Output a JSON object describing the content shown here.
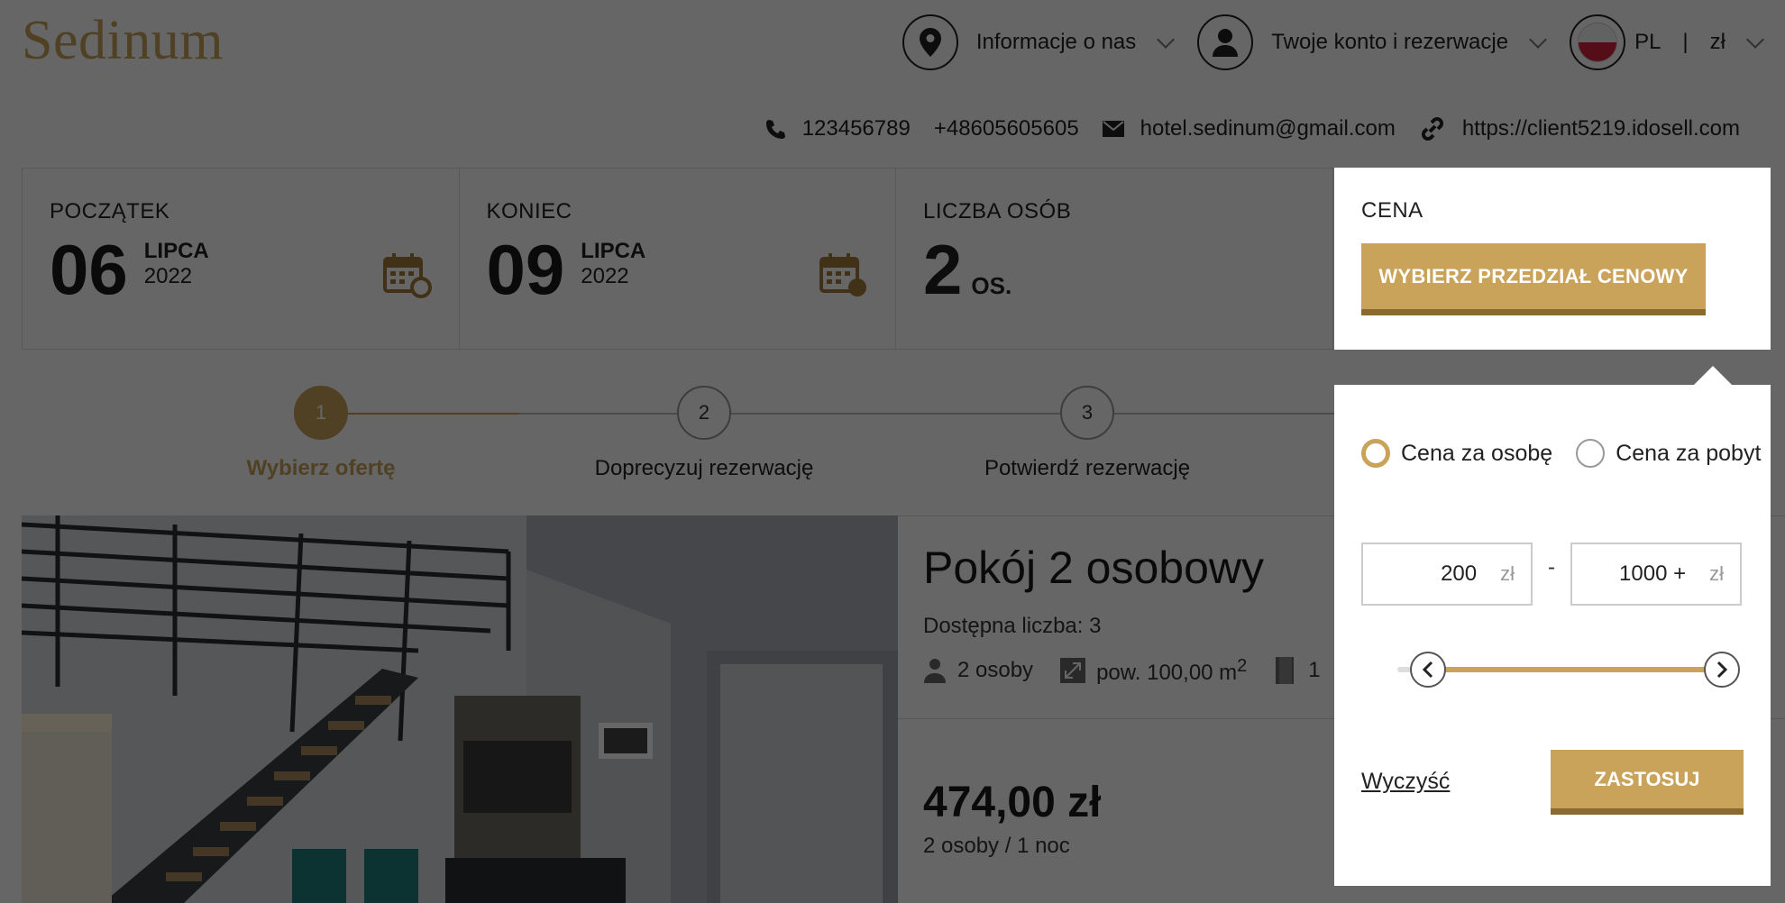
{
  "brand": {
    "logo": "Sedinum",
    "accent": "#c9a35a"
  },
  "nav": {
    "about": "Informacje o nas",
    "account": "Twoje konto i rezerwacje",
    "lang": "PL",
    "separator": "|",
    "currency": "zł"
  },
  "contacts": {
    "phone1": "123456789",
    "phone2": "+48605605605",
    "email": "hotel.sedinum@gmail.com",
    "url": "https://client5219.idosell.com"
  },
  "search": {
    "start": {
      "label": "POCZĄTEK",
      "day": "06",
      "month": "LIPCA",
      "year": "2022"
    },
    "end": {
      "label": "KONIEC",
      "day": "09",
      "month": "LIPCA",
      "year": "2022"
    },
    "persons": {
      "label": "LICZBA OSÓB",
      "count": "2",
      "unit": "OS."
    },
    "price": {
      "label": "CENA",
      "button": "WYBIERZ PRZEDZIAŁ CENOWY"
    }
  },
  "steps": [
    {
      "num": "1",
      "label": "Wybierz ofertę",
      "active": true
    },
    {
      "num": "2",
      "label": "Doprecyzuj rezerwację",
      "active": false
    },
    {
      "num": "3",
      "label": "Potwierdź rezerwację",
      "active": false
    }
  ],
  "room": {
    "title": "Pokój 2 osobowy",
    "availability": "Dostępna liczba: 3",
    "persons": "2 osoby",
    "area": "pow. 100,00 m",
    "area_sup": "2",
    "extra": "1",
    "price": "474,00 zł",
    "price_note": "2 osoby / 1 noc"
  },
  "price_filter": {
    "option_per_person": "Cena za osobę",
    "option_per_stay": "Cena za pobyt",
    "selected": "per_person",
    "min": "200",
    "max": "1000 +",
    "unit": "zł",
    "range_separator": "-",
    "clear": "Wyczyść",
    "apply": "ZASTOSUJ"
  }
}
